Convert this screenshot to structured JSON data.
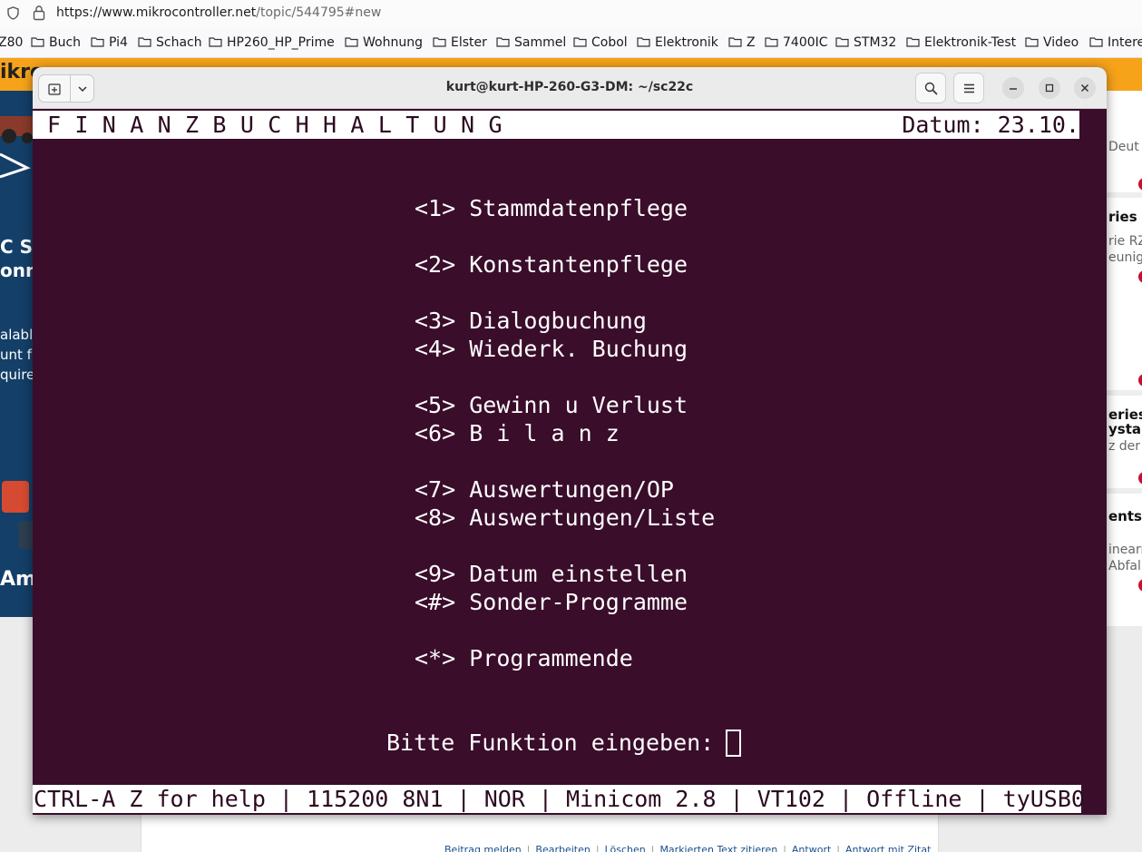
{
  "browser": {
    "url_domain": "https://www.mikrocontroller.net",
    "url_path": "/topic/544795#new",
    "bookmarks": [
      "Z80",
      "Buch",
      "Pi4",
      "Schach",
      "HP260_HP_Prime",
      "Wohnung",
      "Elster",
      "Sammel",
      "Cobol",
      "Elektronik",
      "Z",
      "7400IC",
      "STM32",
      "Elektronik-Test",
      "Video",
      "Intere"
    ]
  },
  "background_page": {
    "logo": "ikro",
    "ad_texts": [
      "C Se",
      "onne",
      "alabl",
      "unt f",
      "quire",
      "Amp"
    ],
    "right_texts": [
      "Deut",
      "ries",
      "rie RZ",
      "eunig",
      "eries",
      "ystal",
      "z der",
      "ents",
      "inearr",
      "Abfal"
    ],
    "footer_links": [
      "Beitrag melden",
      "Bearbeiten",
      "Löschen",
      "Markierten Text zitieren",
      "Antwort",
      "Antwort mit Zitat"
    ]
  },
  "terminal": {
    "window_title": "kurt@kurt-HP-260-G3-DM: ~/sc22c",
    "header_left": "F I N A N Z B U C H H A L T U N G",
    "header_right": "Datum: 23.10.",
    "menu": [
      {
        "key": "<1>",
        "label": "Stammdatenpflege"
      },
      {
        "key": "<2>",
        "label": "Konstantenpflege"
      },
      {
        "key": "<3>",
        "label": "Dialogbuchung"
      },
      {
        "key": "<4>",
        "label": "Wiederk. Buchung"
      },
      {
        "key": "<5>",
        "label": "Gewinn u Verlust"
      },
      {
        "key": "<6>",
        "label": "B i l a n z"
      },
      {
        "key": "<7>",
        "label": "Auswertungen/OP"
      },
      {
        "key": "<8>",
        "label": "Auswertungen/Liste"
      },
      {
        "key": "<9>",
        "label": "Datum einstellen"
      },
      {
        "key": "<#>",
        "label": "Sonder-Programme"
      },
      {
        "key": "<*>",
        "label": "Programmende"
      }
    ],
    "prompt": "Bitte Funktion eingeben:",
    "status_line": "CTRL-A Z for help | 115200 8N1 | NOR | Minicom 2.8 | VT102 | Offline | tyUSB0"
  },
  "colors": {
    "terminal_bg": "#3a0d2b",
    "terminal_fg": "#ffffff",
    "site_accent": "#f6a31a",
    "ad_bg": "#143f68"
  }
}
